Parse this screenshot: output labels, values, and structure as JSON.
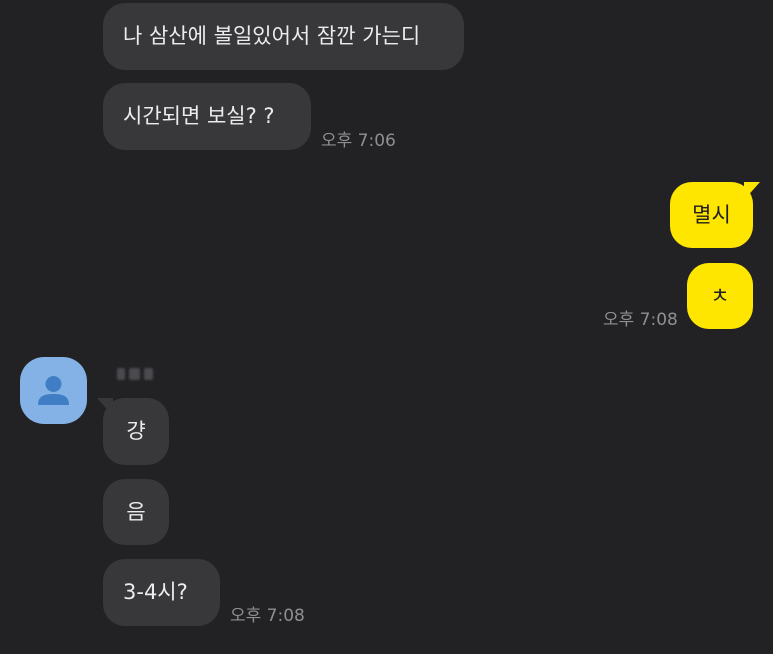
{
  "messages": {
    "in1": "나 삼산에 볼일있어서 잠깐 가는디",
    "in2": "시간되면 보실? ?",
    "time1": "오후 7:06",
    "out1": "멸시",
    "out2": "ㅊ",
    "time2": "오후 7:08",
    "in3": "걍",
    "in4": "음",
    "in5": "3-4시?",
    "time3": "오후 7:08"
  },
  "colors": {
    "background": "#222124",
    "incoming_bubble": "#38383b",
    "outgoing_bubble": "#ffe600",
    "avatar": "#84b2e6",
    "timestamp": "#8f8f93"
  },
  "icons": {
    "avatar": "default-person-icon"
  }
}
